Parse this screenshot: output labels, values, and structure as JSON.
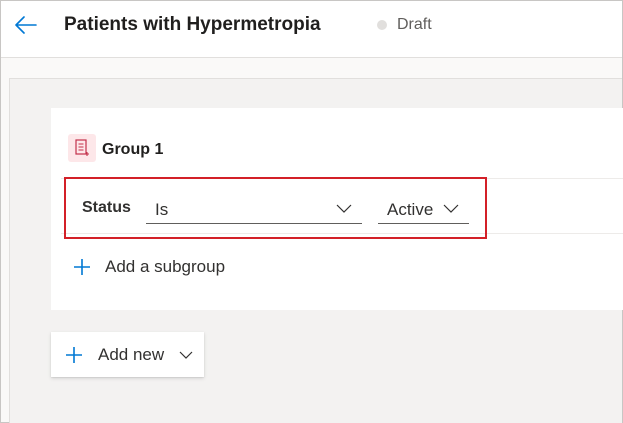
{
  "header": {
    "title": "Patients with Hypermetropia",
    "status": "Draft",
    "back_icon": "arrow-left-icon"
  },
  "group": {
    "title": "Group 1",
    "icon": "segment-group-icon",
    "condition": {
      "attribute": "Status",
      "operator": "Is",
      "value": "Active"
    },
    "add_subgroup_label": "Add a subgroup"
  },
  "add_new": {
    "label": "Add new"
  },
  "colors": {
    "accent": "#0078d4",
    "highlight": "#d32028",
    "group_icon_bg": "#fde7e9",
    "group_icon_fg": "#c4314b"
  }
}
